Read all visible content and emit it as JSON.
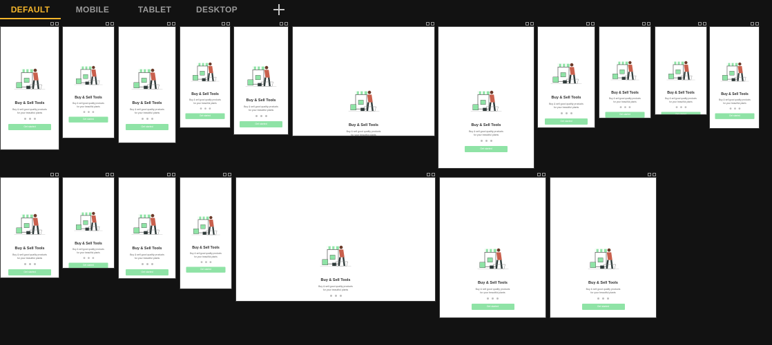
{
  "tabs": [
    "DEFAULT",
    "MOBILE",
    "TABLET",
    "DESKTOP"
  ],
  "active_tab": "DEFAULT",
  "icons": {
    "add": "plus-icon",
    "illustration": "shopping-illustration-icon"
  },
  "colors": {
    "background": "#121212",
    "accent": "#f5b62b",
    "cta": "#8fe3a6",
    "screen": "#ffffff"
  },
  "screen": {
    "title": "Buy & Sell Tools",
    "subtitle_line1": "Buy & sell good quality products",
    "subtitle_line2": "for your beautiful plants",
    "cta": "Get started"
  }
}
